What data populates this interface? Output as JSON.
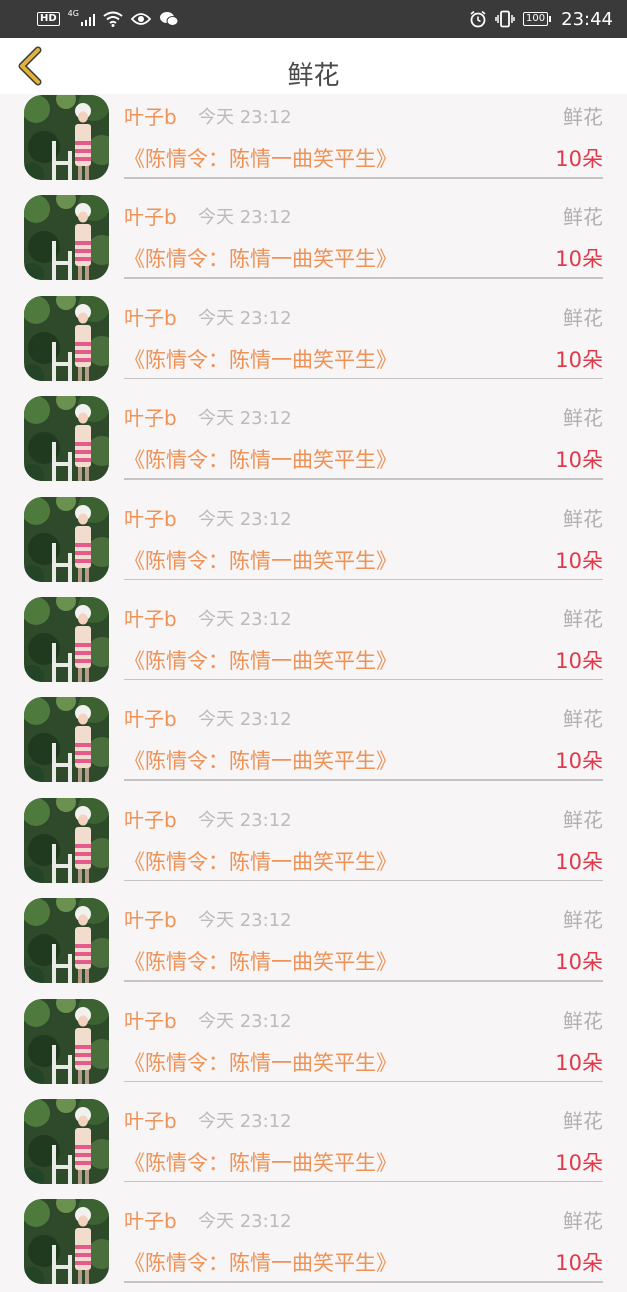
{
  "status_bar": {
    "hd": "HD",
    "network": "4G",
    "battery": "100",
    "time": "23:44"
  },
  "header": {
    "title": "鲜花",
    "back_icon": "chevron-left-icon"
  },
  "colors": {
    "accent": "#ee9257",
    "count": "#e0394a",
    "muted": "#bbbbbb"
  },
  "records": [
    {
      "user": "叶子b",
      "time": "今天 23:12",
      "type": "鲜花",
      "work": "《陈情令：陈情一曲笑平生》",
      "count": "10朵"
    },
    {
      "user": "叶子b",
      "time": "今天 23:12",
      "type": "鲜花",
      "work": "《陈情令：陈情一曲笑平生》",
      "count": "10朵"
    },
    {
      "user": "叶子b",
      "time": "今天 23:12",
      "type": "鲜花",
      "work": "《陈情令：陈情一曲笑平生》",
      "count": "10朵"
    },
    {
      "user": "叶子b",
      "time": "今天 23:12",
      "type": "鲜花",
      "work": "《陈情令：陈情一曲笑平生》",
      "count": "10朵"
    },
    {
      "user": "叶子b",
      "time": "今天 23:12",
      "type": "鲜花",
      "work": "《陈情令：陈情一曲笑平生》",
      "count": "10朵"
    },
    {
      "user": "叶子b",
      "time": "今天 23:12",
      "type": "鲜花",
      "work": "《陈情令：陈情一曲笑平生》",
      "count": "10朵"
    },
    {
      "user": "叶子b",
      "time": "今天 23:12",
      "type": "鲜花",
      "work": "《陈情令：陈情一曲笑平生》",
      "count": "10朵"
    },
    {
      "user": "叶子b",
      "time": "今天 23:12",
      "type": "鲜花",
      "work": "《陈情令：陈情一曲笑平生》",
      "count": "10朵"
    },
    {
      "user": "叶子b",
      "time": "今天 23:12",
      "type": "鲜花",
      "work": "《陈情令：陈情一曲笑平生》",
      "count": "10朵"
    },
    {
      "user": "叶子b",
      "time": "今天 23:12",
      "type": "鲜花",
      "work": "《陈情令：陈情一曲笑平生》",
      "count": "10朵"
    },
    {
      "user": "叶子b",
      "time": "今天 23:12",
      "type": "鲜花",
      "work": "《陈情令：陈情一曲笑平生》",
      "count": "10朵"
    },
    {
      "user": "叶子b",
      "time": "今天 23:12",
      "type": "鲜花",
      "work": "《陈情令：陈情一曲笑平生》",
      "count": "10朵"
    }
  ]
}
